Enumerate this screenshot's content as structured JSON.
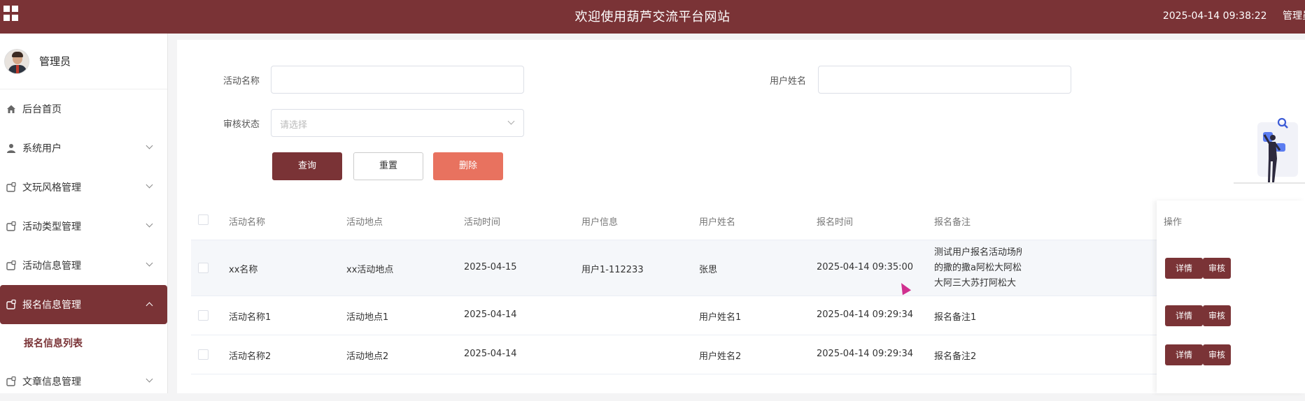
{
  "header": {
    "title": "欢迎使用葫芦交流平台网站",
    "datetime": "2025-04-14 09:38:22",
    "user_label": "管理员"
  },
  "sidebar": {
    "username": "管理员",
    "items": [
      {
        "label": "后台首页",
        "icon": "home-icon"
      },
      {
        "label": "系统用户",
        "icon": "user-icon"
      },
      {
        "label": "文玩风格管理",
        "icon": "module-icon"
      },
      {
        "label": "活动类型管理",
        "icon": "module-icon"
      },
      {
        "label": "活动信息管理",
        "icon": "module-icon"
      },
      {
        "label": "报名信息管理",
        "icon": "module-icon"
      },
      {
        "label": "文章信息管理",
        "icon": "module-icon"
      }
    ],
    "submenu": {
      "label": "报名信息列表"
    }
  },
  "search": {
    "activity_name_label": "活动名称",
    "user_name_label": "用户姓名",
    "audit_status_label": "审核状态",
    "audit_status_placeholder": "请选择",
    "query_label": "查询",
    "reset_label": "重置",
    "delete_label": "删除"
  },
  "table": {
    "columns": [
      "活动名称",
      "活动地点",
      "活动时间",
      "用户信息",
      "用户姓名",
      "报名时间",
      "报名备注",
      "操作"
    ],
    "rows": [
      {
        "name": "xx名称",
        "place": "xx活动地点",
        "time": "2025-04-15",
        "user_info": "用户1-112233",
        "user_name": "张思",
        "signup_time": "2025-04-14 09:35:00",
        "remark_lines": [
          "测试用户报名活动场所",
          "的撒的撒a阿松大阿松",
          "大阿三大苏打阿松大"
        ]
      },
      {
        "name": "活动名称1",
        "place": "活动地点1",
        "time": "2025-04-14",
        "user_info": "",
        "user_name": "用户姓名1",
        "signup_time": "2025-04-14 09:29:34",
        "remark_lines": [
          "报名备注1"
        ]
      },
      {
        "name": "活动名称2",
        "place": "活动地点2",
        "time": "2025-04-14",
        "user_info": "",
        "user_name": "用户姓名2",
        "signup_time": "2025-04-14 09:29:34",
        "remark_lines": [
          "报名备注2"
        ]
      }
    ],
    "detail_label": "详情",
    "audit_label": "审核"
  },
  "colors": {
    "brand": "#7a3336",
    "delete": "#e8725f"
  }
}
